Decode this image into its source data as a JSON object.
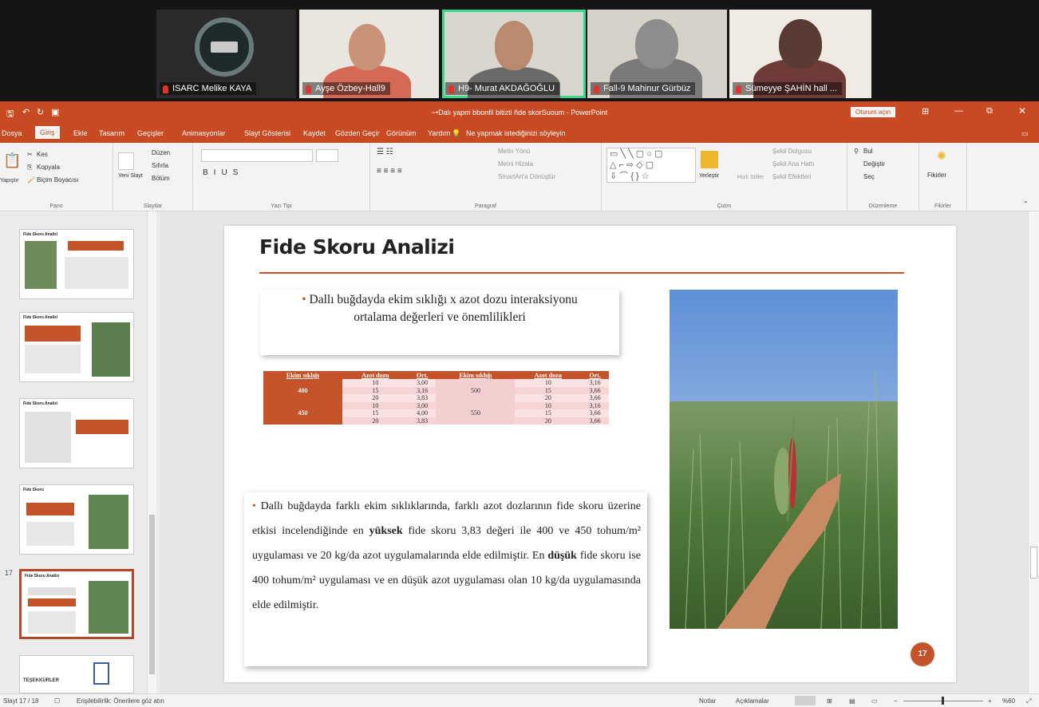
{
  "meeting": {
    "participants": [
      {
        "name": "ISARC Melike KAYA",
        "active": false
      },
      {
        "name": "Ayşe Özbey-Hall9",
        "active": false
      },
      {
        "name": "H9- Murat AKDAĞOĞLU",
        "active": true
      },
      {
        "name": "Fall-9 Mahinur Gürbüz",
        "active": false
      },
      {
        "name": "Sümeyye ŞAHİN hall ...",
        "active": false
      }
    ]
  },
  "app": {
    "title": "~•Dalı yapm bbonfil bitizti ñde skorSuoum - PowerPoint",
    "share_button": "Oturum açın",
    "tabs": [
      "Dosya",
      "Giriş",
      "Ekle",
      "Tasarım",
      "Geçişler",
      "Animasyonlar",
      "Slayt Gösterisi",
      "Kaydet",
      "Gözden Geçir",
      "Görünüm",
      "Yardım",
      "Ne yapmak istediğinizi söyleyin"
    ],
    "active_tab": "Giriş"
  },
  "ribbon": {
    "clipboard": {
      "paste": "Yapıştır",
      "cut": "Kes",
      "copy": "Kopyala",
      "format_painter": "Biçim Boyacısı",
      "label": "Pano"
    },
    "slides": {
      "new_slide": "Yeni Slayt",
      "layout": "Düzen",
      "reset": "Sıfırla",
      "section": "Bölüm",
      "label": "Slaytlar"
    },
    "font": {
      "label": "Yazı Tipi"
    },
    "paragraph": {
      "text_direction": "Metin Yönü",
      "align_text": "Metni Hizala",
      "smartart": "SmartArt'a Dönüştür",
      "label": "Paragraf"
    },
    "drawing": {
      "arrange": "Yerleştir",
      "quick_styles": "Hızlı Stiller",
      "shape_fill": "Şekil Dolgusu",
      "shape_outline": "Şekil Ana Hattı",
      "shape_effects": "Şekil Efektleri",
      "label": "Çizim"
    },
    "editing": {
      "find": "Bul",
      "replace": "Değiştir",
      "select": "Seç",
      "label": "Düzenleme"
    },
    "designer": {
      "ideas": "Fikirler",
      "label": "Fikirler"
    }
  },
  "thumbnails": [
    {
      "num": "",
      "title": "Fide Skoru Analizi"
    },
    {
      "num": "",
      "title": "Fide Skoru Analizi"
    },
    {
      "num": "",
      "title": "Fide Skoru Analizi"
    },
    {
      "num": "",
      "title": "Fide Skoru"
    },
    {
      "num": "17",
      "title": "Fide Skoru Analizi",
      "selected": true
    },
    {
      "num": "",
      "title": "TEŞEKKÜRLER"
    }
  ],
  "slide": {
    "title": "Fide Skoru Analizi",
    "callout_line1": "Dallı buğdayda ekim sıklığı x azot dozu interaksiyonu",
    "callout_line2": "ortalama değerleri ve önemlilikleri",
    "table": {
      "headers": [
        "Ekim sıklığı",
        "Azot dozu",
        "Ort.",
        "Ekim sıklığı",
        "Azot dozu",
        "Ort."
      ],
      "rows": [
        [
          "400",
          "10",
          "3,00",
          "500",
          "10",
          "3,16"
        ],
        [
          "",
          "15",
          "3,16",
          "",
          "15",
          "3,66"
        ],
        [
          "",
          "20",
          "3,83",
          "",
          "20",
          "3,66"
        ],
        [
          "450",
          "10",
          "3,00",
          "550",
          "10",
          "3,16"
        ],
        [
          "",
          "15",
          "4,00",
          "",
          "15",
          "3,66"
        ],
        [
          "",
          "20",
          "3,83",
          "",
          "20",
          "3,66"
        ]
      ]
    },
    "paragraph": {
      "p1": "Dallı buğdayda farklı ekim sıklıklarında, farklı azot dozlarının fide skoru üzerine etkisi incelendiğinde en ",
      "b1": "yüksek",
      "p2": " fide skoru 3,83 değeri ile 400 ve 450 tohum/m² uygulaması ve 20 kg/da azot uygulamalarında elde edilmiştir. En ",
      "b2": "düşük",
      "p3": " fide skoru ise 400 tohum/m² uygulaması ve en düşük azot uygulaması olan 10 kg/da uygulamasında elde edilmiştir."
    },
    "page_number": "17"
  },
  "status": {
    "slide_count": "Slayt 17 / 18",
    "accessibility": "Erişilebilirlik: Önerilere göz atın",
    "notes": "Notlar",
    "comments": "Açıklamalar",
    "zoom": "%60"
  },
  "colors": {
    "accent": "#c4532a",
    "ribbon_bar": "#c84a23"
  }
}
